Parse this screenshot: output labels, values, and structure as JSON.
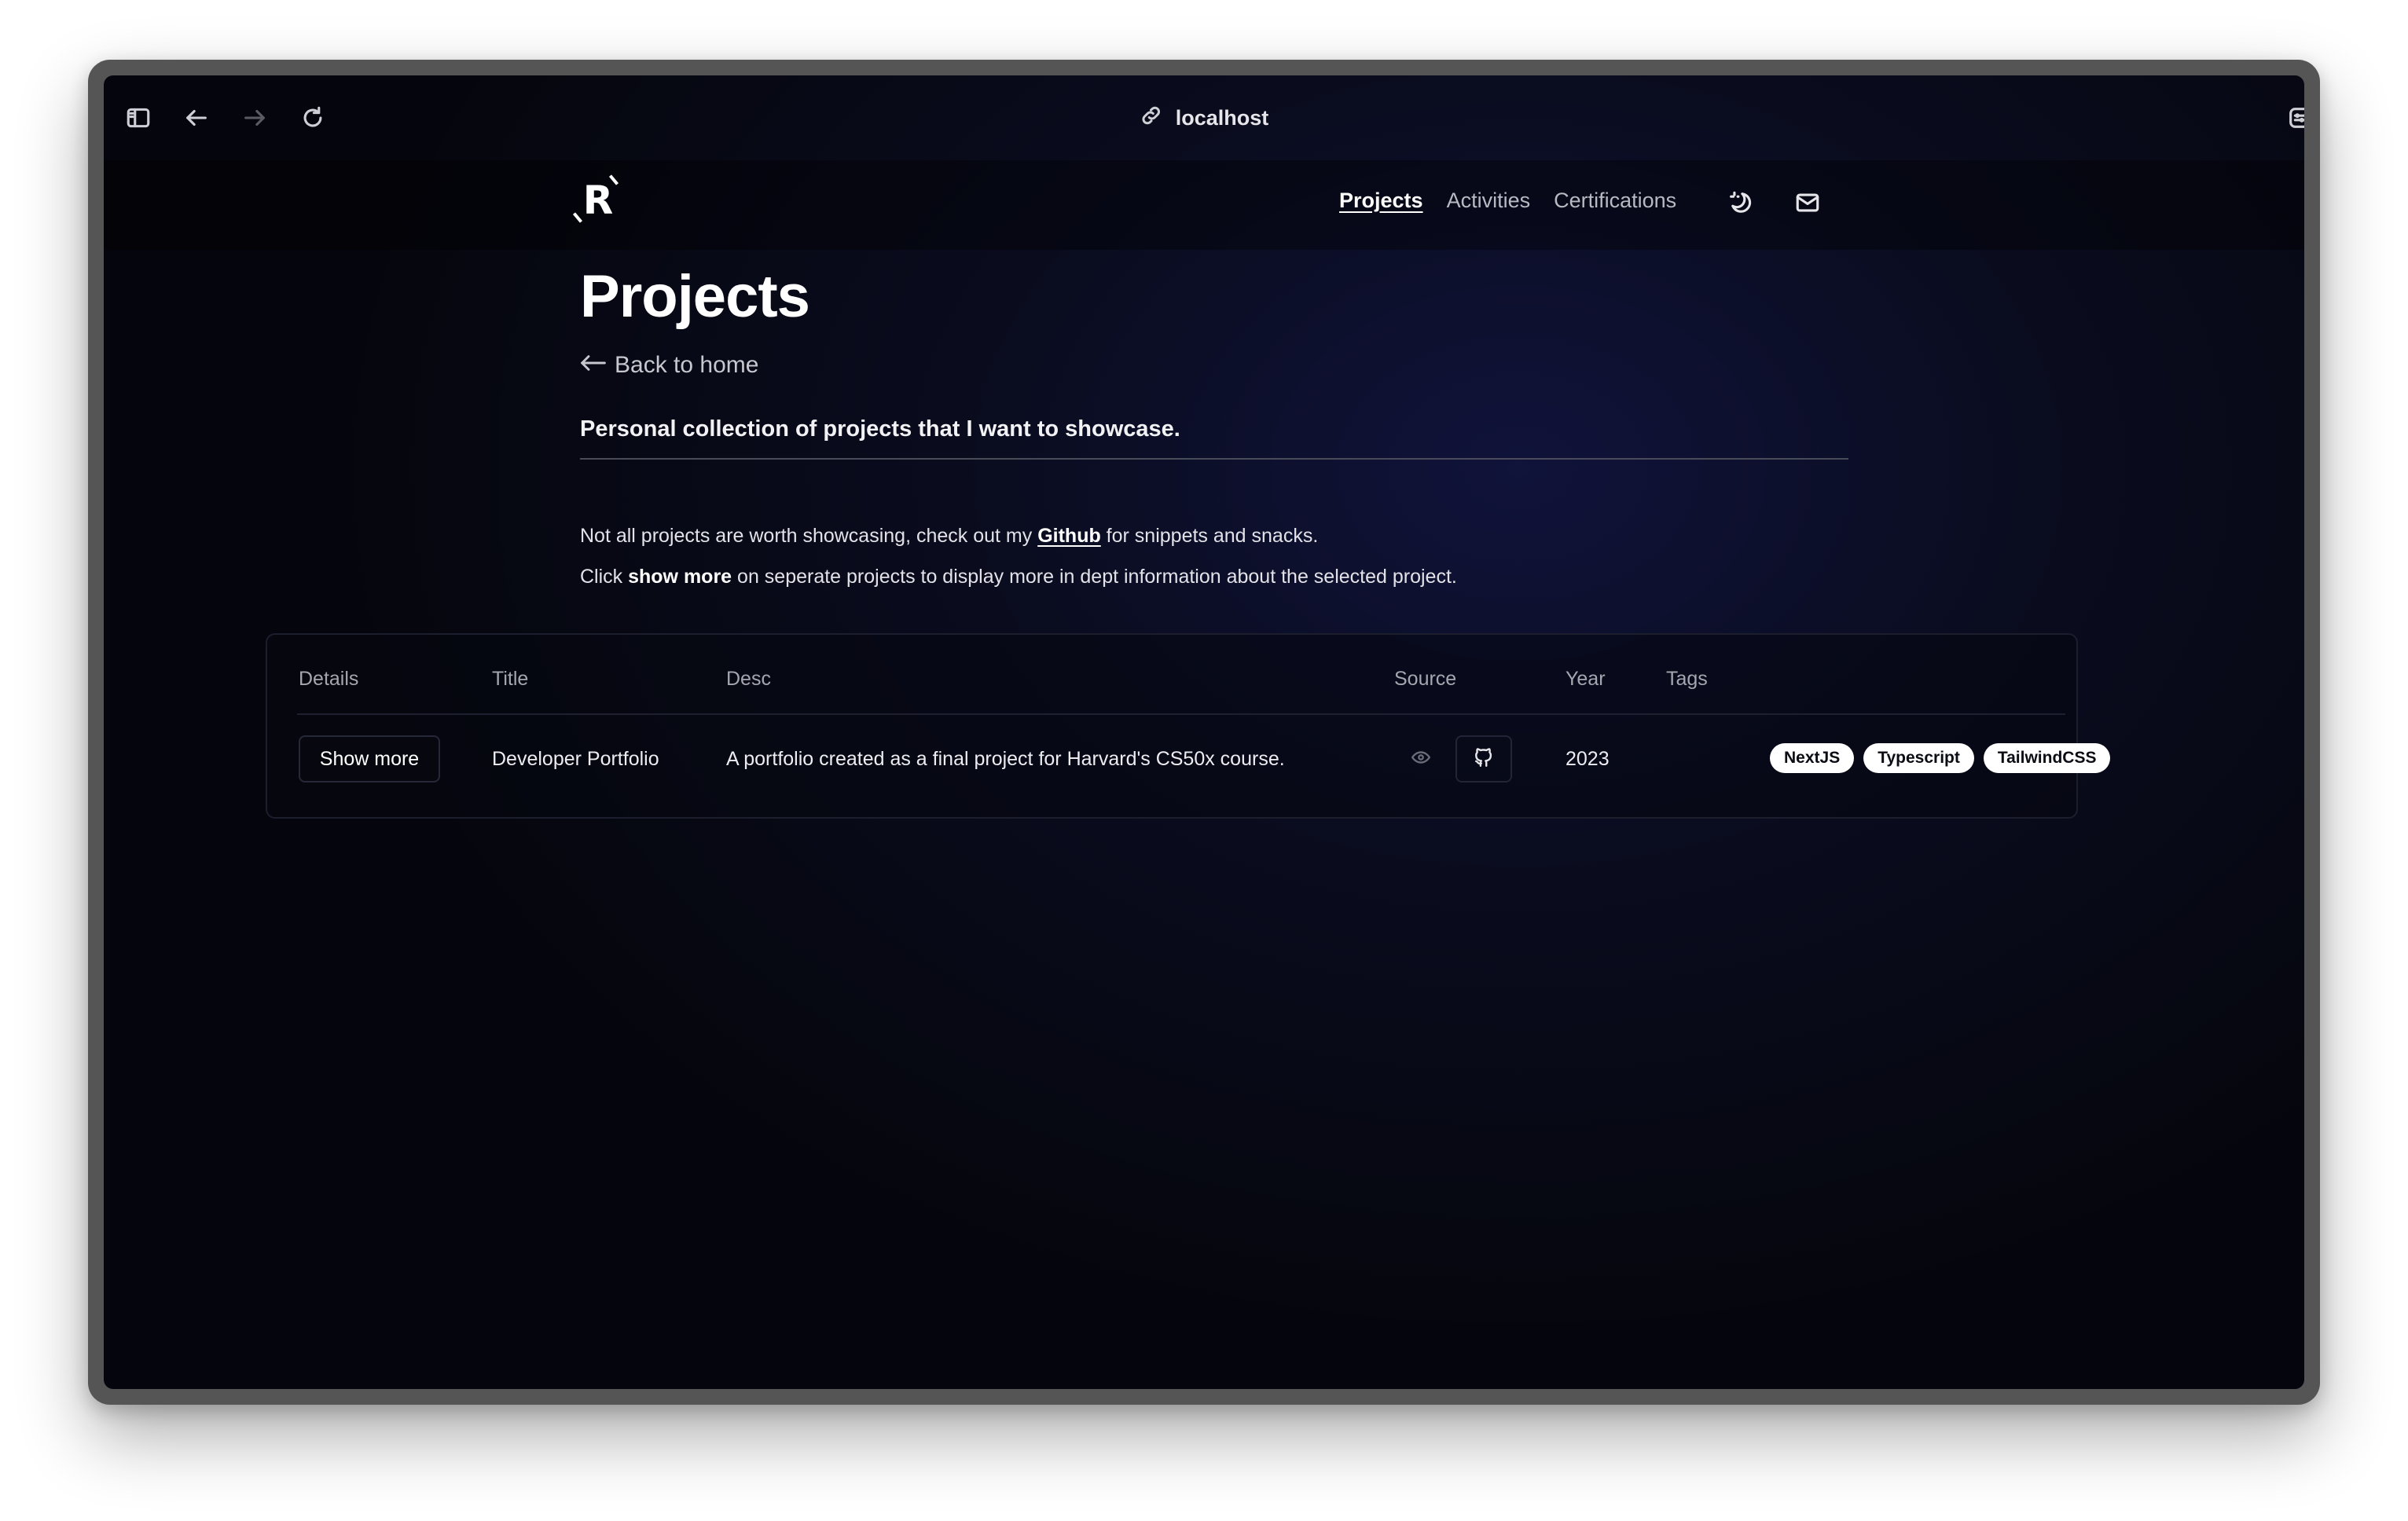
{
  "browser": {
    "url": "localhost"
  },
  "nav": {
    "links": [
      "Projects",
      "Activities",
      "Certifications"
    ],
    "active": "Projects"
  },
  "page": {
    "title": "Projects",
    "back_label": "Back to home",
    "lead": "Personal collection of projects that I want to showcase.",
    "para1_pre": "Not all projects are worth showcasing, check out my ",
    "para1_link": "Github",
    "para1_post": " for snippets and snacks.",
    "para2_pre": "Click ",
    "para2_bold": "show more",
    "para2_post": " on seperate projects to display more in dept information about the selected project."
  },
  "table": {
    "headers": [
      "Details",
      "Title",
      "Desc",
      "Source",
      "Year",
      "Tags"
    ],
    "rows": [
      {
        "details_button": "Show more",
        "title": "Developer Portfolio",
        "desc": "A portfolio created as a final project for Harvard's CS50x course.",
        "year": "2023",
        "tags": [
          "NextJS",
          "Typescript",
          "TailwindCSS"
        ]
      }
    ]
  },
  "icons": {
    "sidebar": "sidebar-icon",
    "back": "arrow-left-icon",
    "forward": "arrow-right-icon",
    "reload": "reload-icon",
    "link": "link-icon",
    "extensions": "extension-icon",
    "split": "split-view-icon",
    "theme": "theme-toggle-icon",
    "mail": "mail-icon",
    "view": "eye-icon",
    "github": "github-icon"
  }
}
